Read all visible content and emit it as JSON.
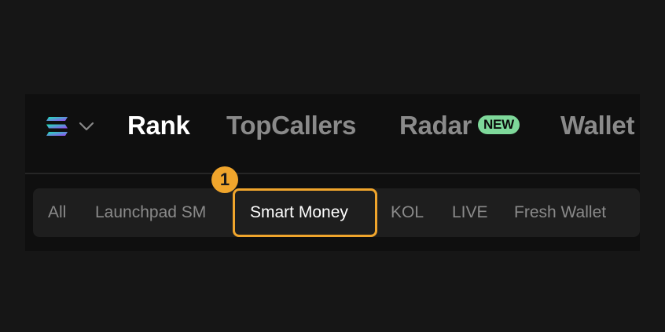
{
  "nav": {
    "tabs": [
      {
        "label": "Rank",
        "active": true
      },
      {
        "label": "TopCallers",
        "active": false
      },
      {
        "label": "Radar",
        "active": false,
        "badge": "NEW"
      },
      {
        "label": "Wallet",
        "active": false
      }
    ],
    "chain_icon": "solana-logo-icon",
    "chain_dropdown_icon": "chevron-down-icon"
  },
  "filters": {
    "items": [
      {
        "label": "All",
        "active": false
      },
      {
        "label": "Launchpad SM",
        "active": false
      },
      {
        "label": "Smart Money",
        "active": true
      },
      {
        "label": "KOL",
        "active": false
      },
      {
        "label": "LIVE",
        "active": false
      },
      {
        "label": "Fresh Wallet",
        "active": false
      }
    ]
  },
  "annotation": {
    "step_number": "1",
    "highlight_color": "#f0a52c"
  },
  "colors": {
    "background": "#161616",
    "panel": "#0f0f0f",
    "filter_bar": "#1e1e1e",
    "badge": "#7ed89a",
    "inactive_text": "#8a8a8a",
    "active_text": "#ffffff"
  }
}
